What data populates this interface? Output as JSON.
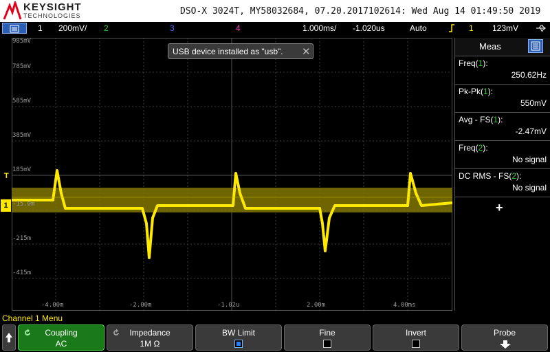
{
  "header": {
    "brand": "KEYSIGHT",
    "brand_sub": "TECHNOLOGIES",
    "model_line": "DSO-X 3024T, MY58032684, 07.20.2017102614: Wed Aug 14 01:49:50 2019"
  },
  "channel_bar": {
    "ch1_num": "1",
    "ch1_scale": "200mV/",
    "ch2_num": "2",
    "ch3_num": "3",
    "ch4_num": "4",
    "timebase": "1.000ms/",
    "delay": "-1.020us",
    "trigger_mode": "Auto",
    "trigger_channel": "1",
    "trigger_level": "123mV",
    "colors": {
      "ch1": "#ffe900",
      "ch2": "#2fd32f",
      "ch3": "#4a6cff",
      "ch4": "#ff3fbf"
    }
  },
  "notification": {
    "text": "USB device installed as \"usb\"."
  },
  "screen": {
    "y_labels": [
      "985mV",
      "785mV",
      "585mV",
      "385mV",
      "185mV",
      "-15.0m",
      "-215m",
      "-415m"
    ],
    "x_labels": [
      "-4.00m",
      "-2.00m",
      "-1.02u",
      "2.00m",
      "4.00ms"
    ],
    "trigger_marker": "T",
    "channel_marker": "1"
  },
  "measurements": {
    "title": "Meas",
    "items": [
      {
        "label_prefix": "Freq(",
        "channel": "1",
        "label_suffix": "):",
        "value": "250.62Hz"
      },
      {
        "label_prefix": "Pk-Pk(",
        "channel": "1",
        "label_suffix": "):",
        "value": "550mV"
      },
      {
        "label_prefix": "Avg - FS(",
        "channel": "1",
        "label_suffix": "):",
        "value": "-2.47mV"
      },
      {
        "label_prefix": "Freq(",
        "channel": "2",
        "label_suffix": "):",
        "value": "No signal"
      },
      {
        "label_prefix": "DC RMS - FS(",
        "channel": "2",
        "label_suffix": "):",
        "value": "No signal"
      }
    ],
    "add_label": "+"
  },
  "menu": {
    "title": "Channel 1 Menu",
    "coupling": {
      "label": "Coupling",
      "value": "AC"
    },
    "impedance": {
      "label": "Impedance",
      "value": "1M Ω"
    },
    "bw_limit": {
      "label": "BW Limit",
      "checked": true
    },
    "fine": {
      "label": "Fine",
      "checked": false
    },
    "invert": {
      "label": "Invert",
      "checked": false
    },
    "probe": {
      "label": "Probe"
    }
  }
}
